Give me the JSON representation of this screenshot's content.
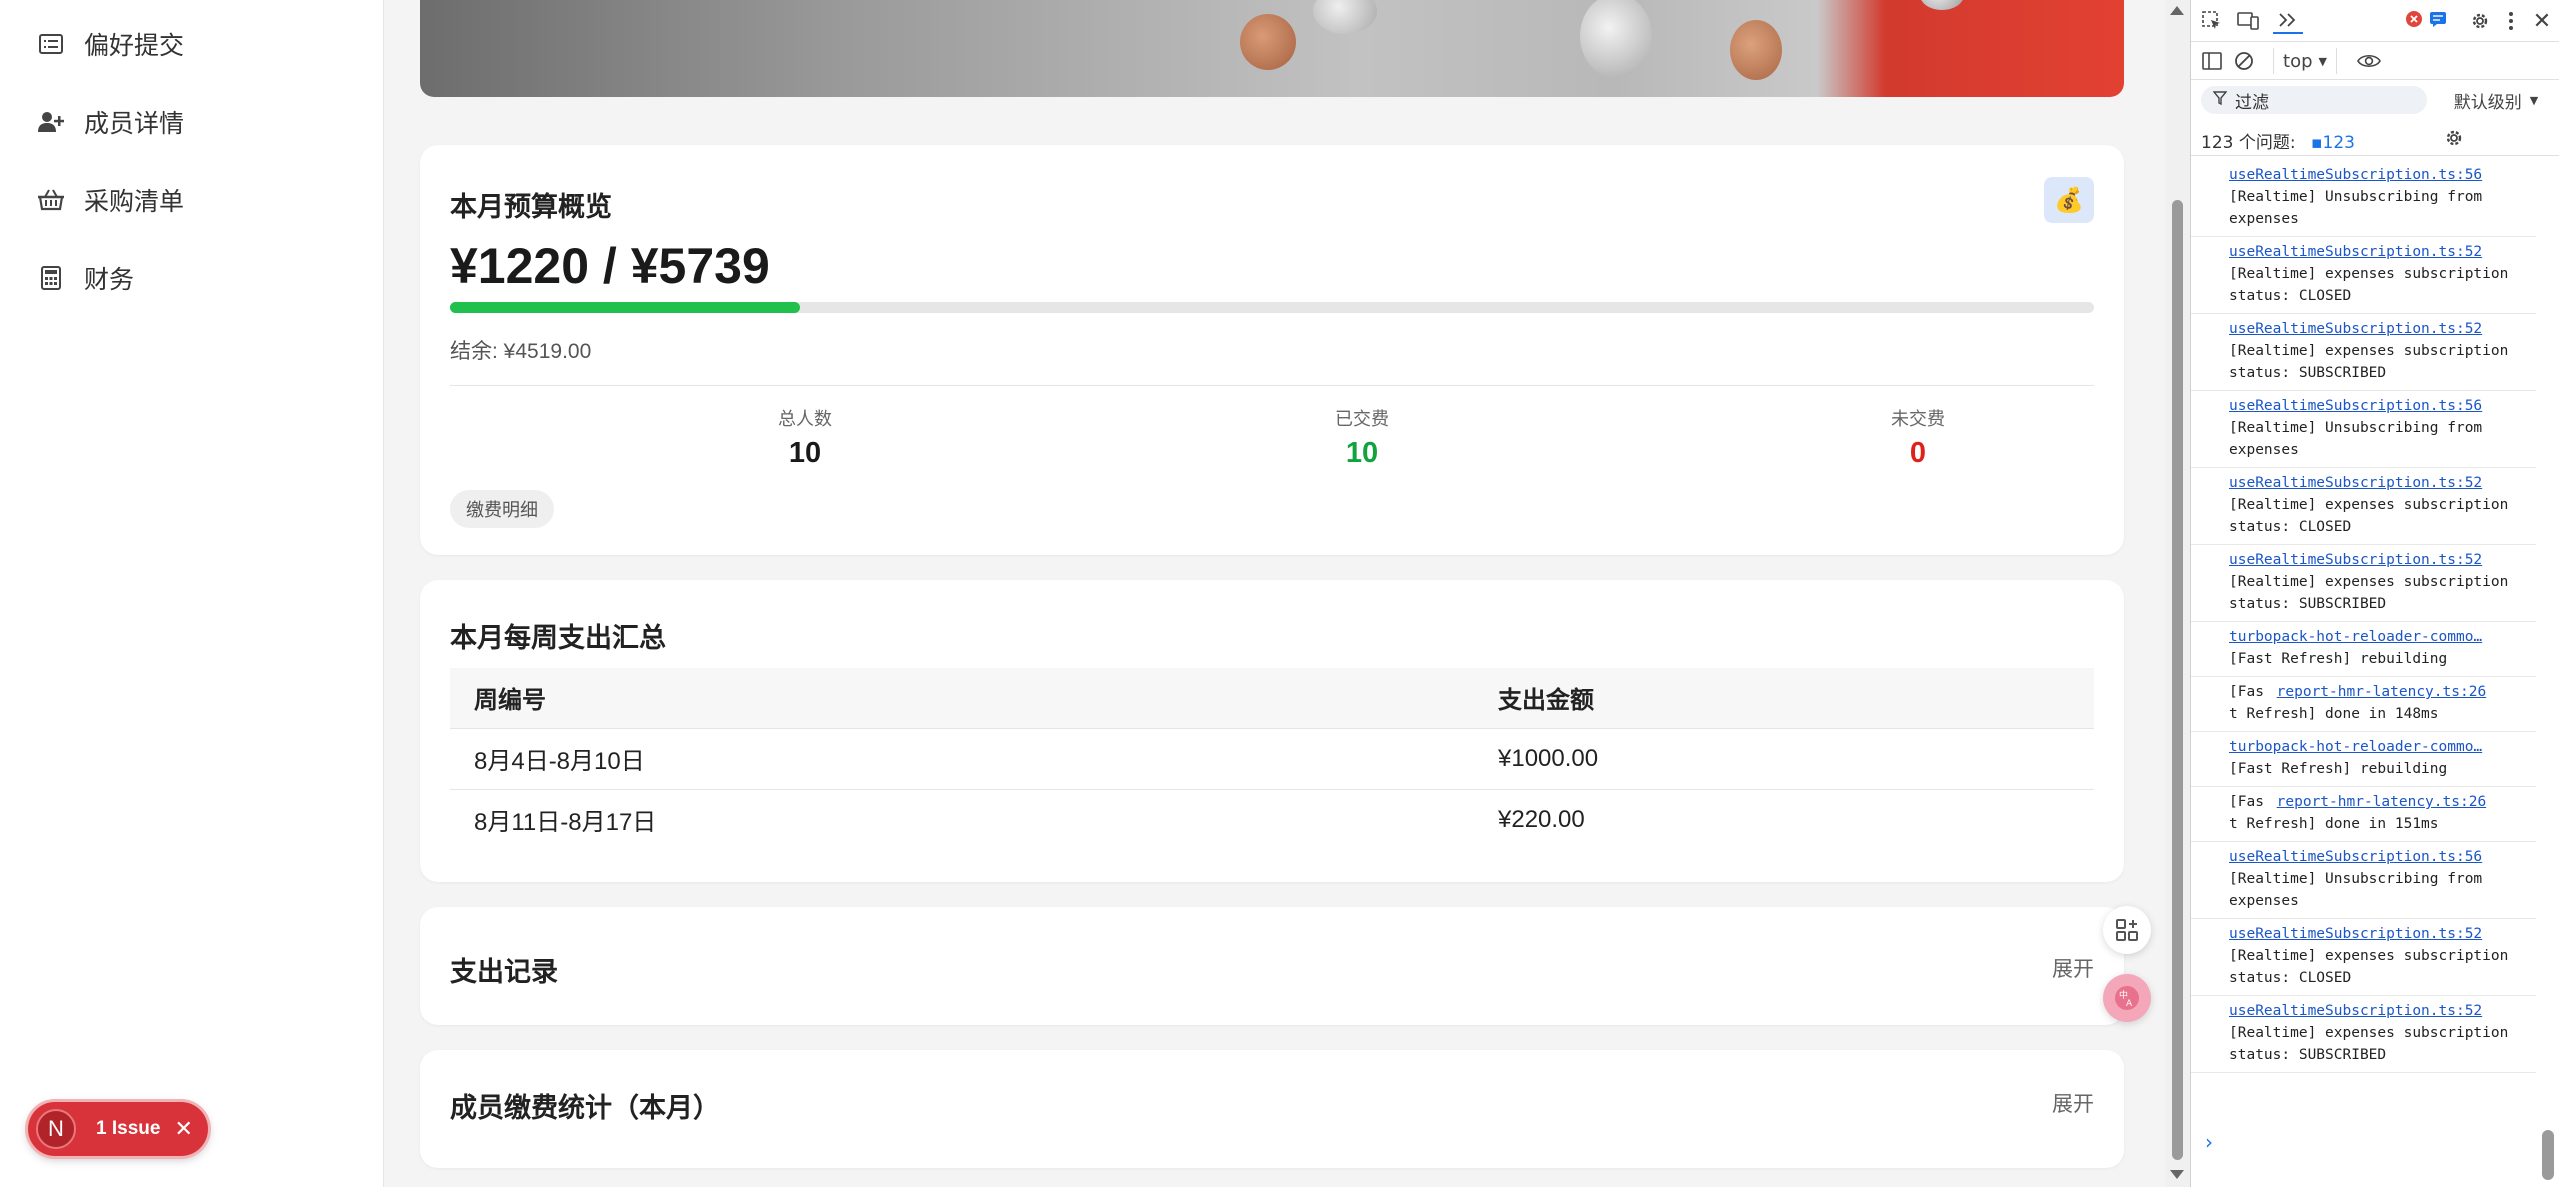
{
  "sidebar": {
    "items": [
      {
        "label": "偏好提交",
        "icon": "list-icon"
      },
      {
        "label": "成员详情",
        "icon": "user-plus-icon"
      },
      {
        "label": "采购清单",
        "icon": "basket-icon"
      },
      {
        "label": "财务",
        "icon": "calculator-icon"
      }
    ],
    "issue_badge": {
      "letter": "N",
      "text": "1 Issue",
      "close": "✕"
    }
  },
  "budget_card": {
    "title": "本月预算概览",
    "icon": "money-bag-icon",
    "spent_total": "¥1220 / ¥5739",
    "progress_fraction": 0.2126,
    "remaining": "结余: ¥4519.00",
    "stats": [
      {
        "label": "总人数",
        "value": "10",
        "color": "#1a1a1a"
      },
      {
        "label": "已交费",
        "value": "10",
        "color": "#12a23e"
      },
      {
        "label": "未交费",
        "value": "0",
        "color": "#e0211a"
      }
    ],
    "detail_chip": "缴费明细"
  },
  "weekly_card": {
    "title": "本月每周支出汇总",
    "columns": [
      "周编号",
      "支出金额"
    ],
    "rows": [
      [
        "8月4日-8月10日",
        "¥1000.00"
      ],
      [
        "8月11日-8月17日",
        "¥220.00"
      ]
    ]
  },
  "expense_card": {
    "title": "支出记录",
    "expand": "展开"
  },
  "member_card": {
    "title": "成员缴费统计（本月）",
    "expand": "展开"
  },
  "devtools": {
    "context": "top",
    "filter_placeholder": "过滤",
    "level": "默认级别",
    "issues_label": "123 个问题:",
    "issues_count": "123",
    "log": [
      {
        "link": "useRealtimeSubscription.ts:56",
        "text": "[Realtime] Unsubscribing from expenses"
      },
      {
        "link": "useRealtimeSubscription.ts:52",
        "text": "[Realtime] expenses subscription status: CLOSED"
      },
      {
        "link": "useRealtimeSubscription.ts:52",
        "text": "[Realtime] expenses subscription status: SUBSCRIBED"
      },
      {
        "link": "useRealtimeSubscription.ts:56",
        "text": "[Realtime] Unsubscribing from expenses"
      },
      {
        "link": "useRealtimeSubscription.ts:52",
        "text": "[Realtime] expenses subscription status: CLOSED"
      },
      {
        "link": "useRealtimeSubscription.ts:52",
        "text": "[Realtime] expenses subscription status: SUBSCRIBED"
      },
      {
        "link": "turbopack-hot-reloader-commo…",
        "text": "[Fast Refresh] rebuilding"
      },
      {
        "prefix": "[Fas ",
        "link": "report-hmr-latency.ts:26",
        "text": "t Refresh] done in 148ms"
      },
      {
        "link": "turbopack-hot-reloader-commo…",
        "text": "[Fast Refresh] rebuilding"
      },
      {
        "prefix": "[Fas ",
        "link": "report-hmr-latency.ts:26",
        "text": "t Refresh] done in 151ms"
      },
      {
        "link": "useRealtimeSubscription.ts:56",
        "text": "[Realtime] Unsubscribing from expenses"
      },
      {
        "link": "useRealtimeSubscription.ts:52",
        "text": "[Realtime] expenses subscription status: CLOSED"
      },
      {
        "link": "useRealtimeSubscription.ts:52",
        "text": "[Realtime] expenses subscription status: SUBSCRIBED"
      }
    ],
    "prompt": "›"
  }
}
